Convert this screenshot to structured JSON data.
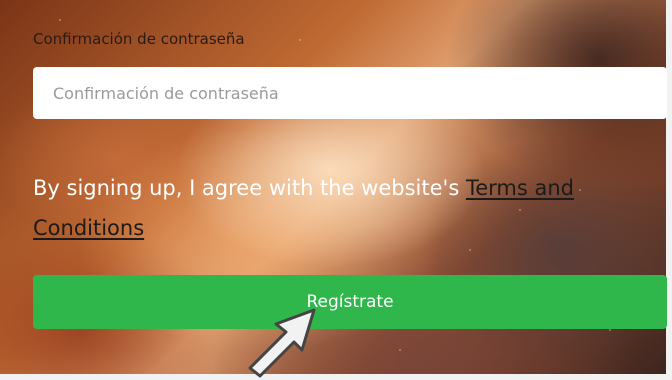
{
  "form": {
    "password_confirm_label": "Confirmación de contraseña",
    "password_confirm_placeholder": "Confirmación de contraseña",
    "terms_prefix": "By signing up, I agree with the website's ",
    "terms_link": "Terms and Conditions",
    "submit_label": "Regístrate"
  },
  "colors": {
    "button": "#2fb74b",
    "input_bg": "#ffffff",
    "text_light": "#ffffff",
    "link": "#1b1b1b"
  },
  "icons": {
    "pointer": "arrow-cursor-icon"
  }
}
